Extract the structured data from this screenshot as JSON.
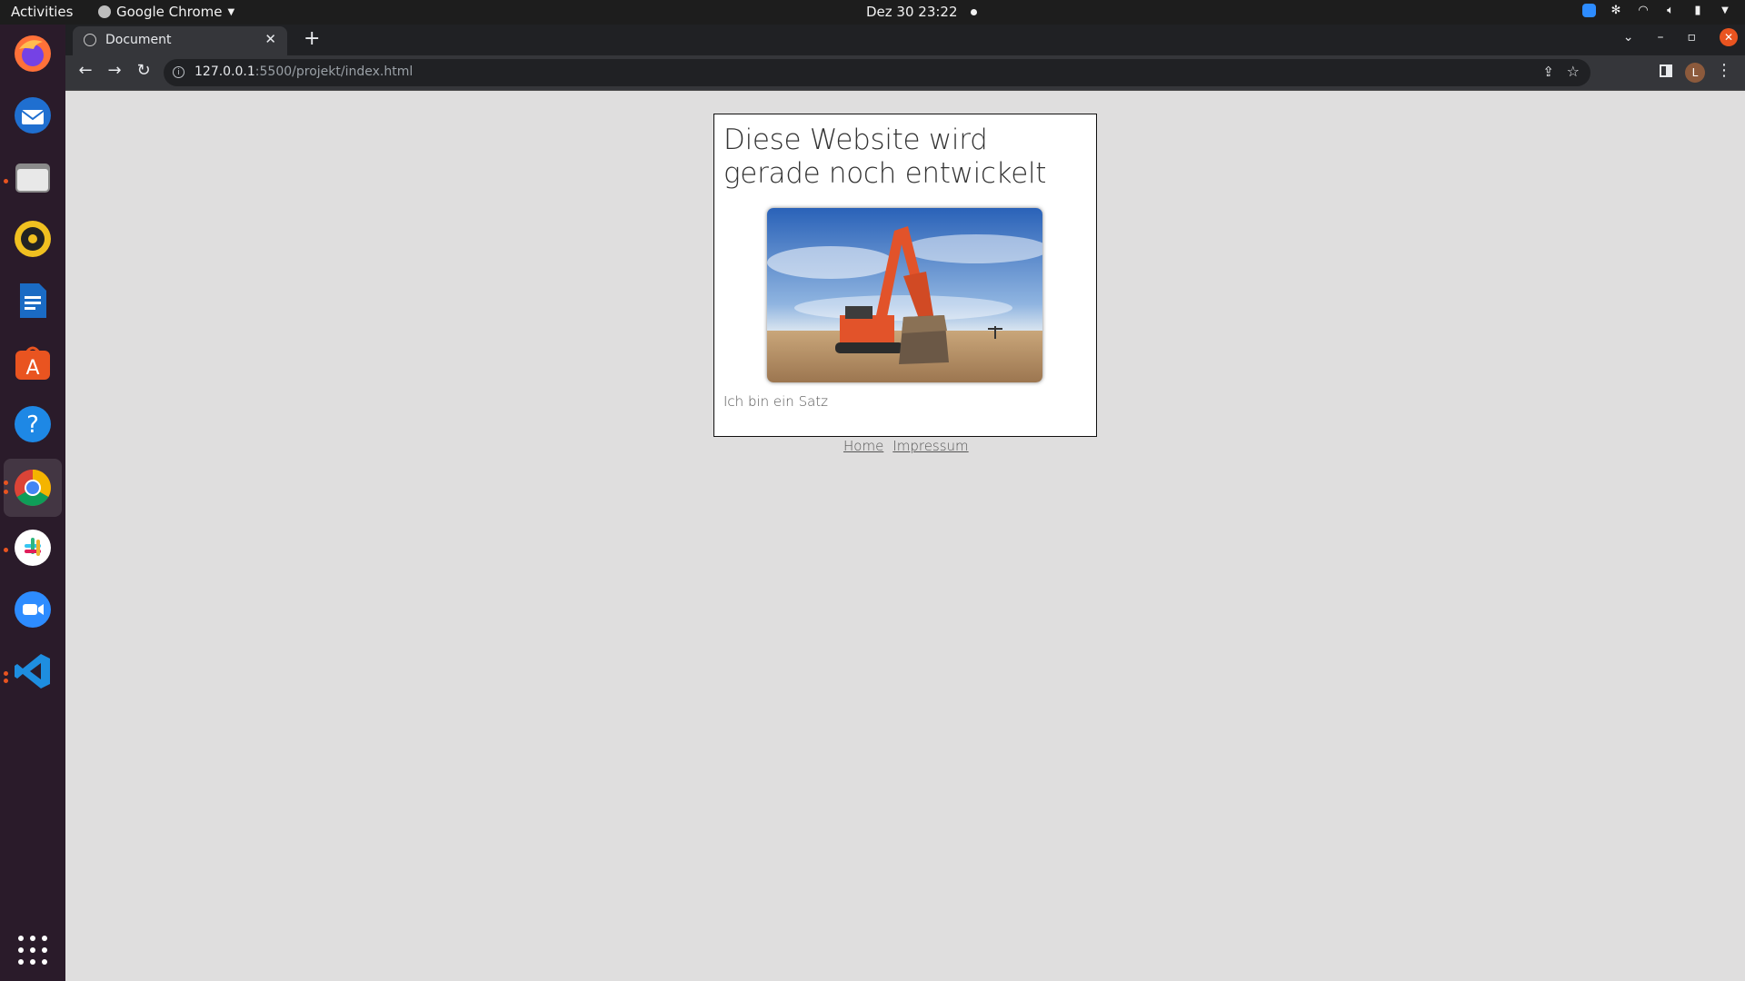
{
  "topbar": {
    "activities": "Activities",
    "app_name": "Google Chrome",
    "datetime": "Dez 30  23:22"
  },
  "dock": {
    "items": [
      "firefox-icon",
      "thunderbird-icon",
      "files-icon",
      "rhythmbox-icon",
      "writer-icon",
      "app-center-icon",
      "help-icon",
      "chrome-icon",
      "slack-icon",
      "zoom-icon",
      "vscode-icon"
    ],
    "apps_grid": "show-applications-icon"
  },
  "browser": {
    "tab_title": "Document",
    "url_host": "127.0.0.1",
    "url_path": ":5500/projekt/index.html",
    "profile_initial": "L"
  },
  "page": {
    "heading": "Diese Website wird gerade noch entwickelt",
    "hero_image": "excavator-photo",
    "sentence": "Ich bin ein Satz",
    "nav": [
      {
        "label": "Home"
      },
      {
        "label": "Impressum"
      }
    ]
  },
  "colors": {
    "page_bg": "#dfdede",
    "ubuntu_orange": "#e95420",
    "chrome_dark": "#202124"
  }
}
